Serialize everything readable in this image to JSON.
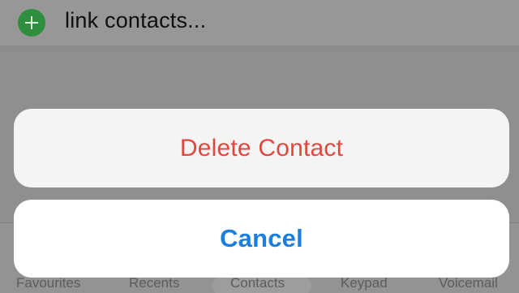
{
  "background": {
    "link_contacts_label": "link contacts...",
    "add_icon": "plus-circle-icon",
    "add_icon_color": "#2f8f3f"
  },
  "tabbar": {
    "tabs": [
      {
        "label": "Favourites"
      },
      {
        "label": "Recents"
      },
      {
        "label": "Contacts",
        "selected": true
      },
      {
        "label": "Keypad"
      },
      {
        "label": "Voicemail"
      }
    ]
  },
  "action_sheet": {
    "delete_label": "Delete Contact",
    "delete_color": "#e2473f",
    "cancel_label": "Cancel",
    "cancel_color": "#1b7fe0"
  }
}
